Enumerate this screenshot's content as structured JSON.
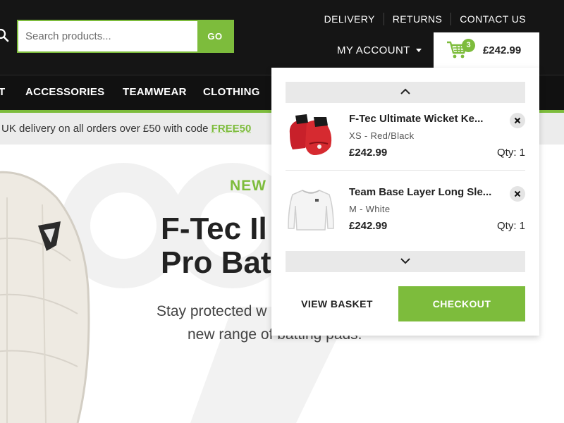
{
  "header": {
    "search": {
      "placeholder": "Search products...",
      "button_label": "GO"
    },
    "top_links": [
      "DELIVERY",
      "RETURNS",
      "CONTACT US"
    ],
    "account_label": "MY ACCOUNT",
    "cart": {
      "count": "3",
      "total": "£242.99"
    }
  },
  "nav": {
    "items": [
      "T",
      "ACCESSORIES",
      "TEAMWEAR",
      "CLOTHING"
    ]
  },
  "promo": {
    "text": "UK delivery on all orders over £50 with code ",
    "code": "FREE50"
  },
  "hero": {
    "tag": "NEW",
    "title_line1": "F-Tec Il",
    "title_line2": "Pro Bat",
    "subtitle_line1": "Stay protected w",
    "subtitle_line2": "new range of batting pads."
  },
  "basket": {
    "items": [
      {
        "name": "F-Tec Ultimate Wicket Ke...",
        "size": "XS",
        "color": "Red/Black",
        "price": "£242.99",
        "qty": "Qty: 1"
      },
      {
        "name": "Team Base Layer Long Sle...",
        "size": "M",
        "color": "White",
        "price": "£242.99",
        "qty": "Qty: 1"
      }
    ],
    "variant_separator": "-",
    "view_basket_label": "VIEW BASKET",
    "checkout_label": "CHECKOUT"
  },
  "colors": {
    "accent": "#7dbc3c",
    "header_bg": "#151515",
    "promo_bg": "#ececec"
  },
  "icons": [
    "search-icon",
    "cart-icon",
    "chevron-up-icon",
    "chevron-down-icon",
    "close-icon",
    "caret-down-icon"
  ]
}
